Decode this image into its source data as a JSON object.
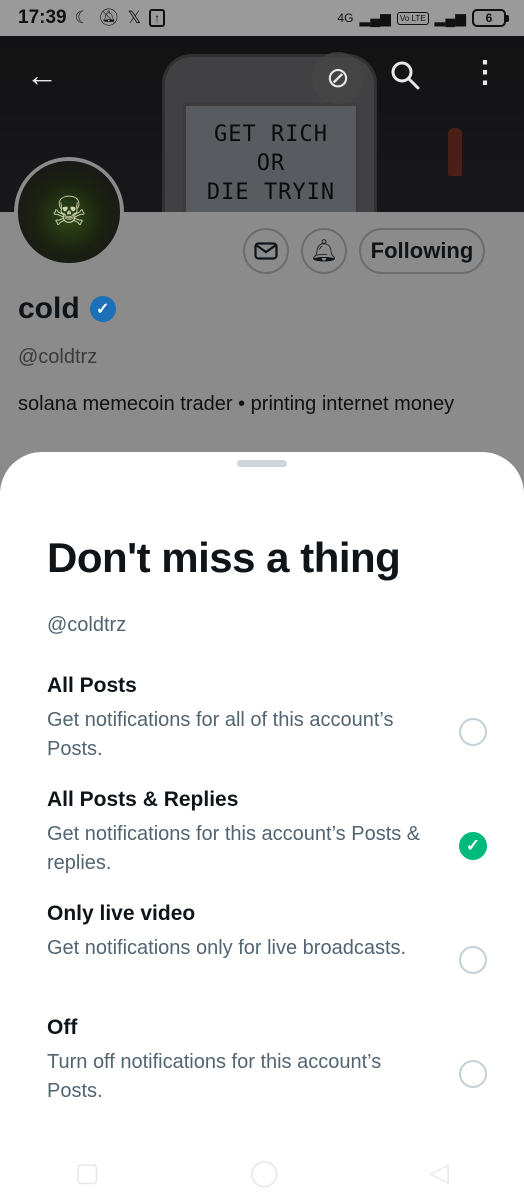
{
  "status_bar": {
    "time": "17:39",
    "network": "4G",
    "volte": "Vo LTE",
    "battery": "6"
  },
  "banner": {
    "marquee_lines": [
      "GET RICH",
      "OR",
      "DIE TRYIN"
    ]
  },
  "profile": {
    "name": "cold",
    "handle": "@coldtrz",
    "bio": "solana memecoin trader • printing internet money",
    "following_label": "Following"
  },
  "sheet": {
    "title": "Don't miss a thing",
    "handle": "@coldtrz",
    "options": [
      {
        "title": "All Posts",
        "desc": "Get notifications for all of this account’s Posts.",
        "selected": false
      },
      {
        "title": "All Posts & Replies",
        "desc": "Get notifications for this account’s Posts & replies.",
        "selected": true
      },
      {
        "title": "Only live video",
        "desc": "Get notifications only for live broadcasts.",
        "selected": false
      },
      {
        "title": "Off",
        "desc": "Turn off notifications for this account’s Posts.",
        "selected": false
      }
    ]
  },
  "colors": {
    "selected": "#00ba7c",
    "verified": "#1d6fb8",
    "secondary_text": "#536471"
  }
}
